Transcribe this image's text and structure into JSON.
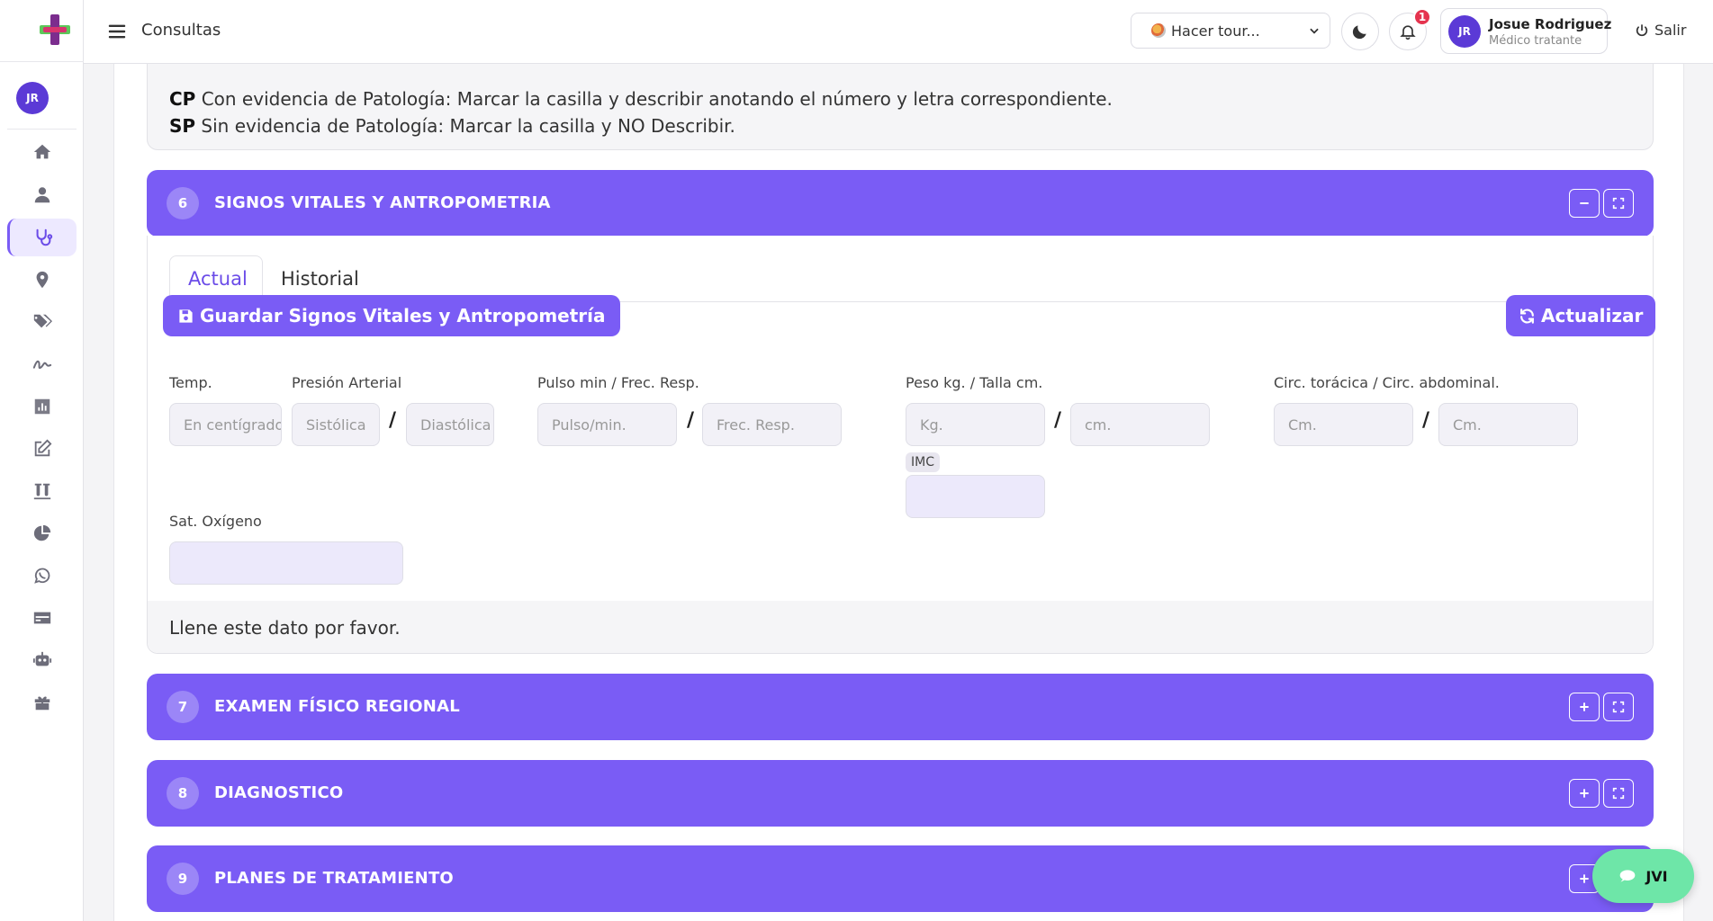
{
  "topbar": {
    "title": "Consultas",
    "tour_label": "Hacer tour...",
    "notification_count": "1",
    "user_initials": "JR",
    "user_name": "Josue Rodriguez",
    "user_role": "Médico tratante",
    "logout_label": "Salir"
  },
  "sidebar": {
    "avatar_initials": "JR",
    "items": [
      {
        "icon": "home-icon",
        "active": false
      },
      {
        "icon": "user-icon",
        "active": false
      },
      {
        "icon": "stethoscope-icon",
        "active": true
      },
      {
        "icon": "map-marker-icon",
        "active": false
      },
      {
        "icon": "tags-icon",
        "active": false
      },
      {
        "icon": "signature-icon",
        "active": false
      },
      {
        "icon": "chart-bar-icon",
        "active": false
      },
      {
        "icon": "edit-icon",
        "active": false
      },
      {
        "icon": "vials-icon",
        "active": false
      },
      {
        "icon": "pie-chart-icon",
        "active": false
      },
      {
        "icon": "whatsapp-icon",
        "active": false
      },
      {
        "icon": "credit-card-icon",
        "active": false
      },
      {
        "icon": "robot-icon",
        "active": false
      },
      {
        "icon": "gift-icon",
        "active": false
      }
    ]
  },
  "info": {
    "cp_code": "CP",
    "cp_text": " Con evidencia de Patología: Marcar la casilla y describir anotando el número y letra correspondiente.",
    "sp_code": "SP",
    "sp_text": " Sin evidencia de Patología: Marcar la casilla y NO Describir."
  },
  "sections": [
    {
      "number": "6",
      "title": "SIGNOS VITALES Y ANTROPOMETRIA",
      "expanded": true
    },
    {
      "number": "7",
      "title": "EXAMEN FÍSICO REGIONAL",
      "expanded": false
    },
    {
      "number": "8",
      "title": "DIAGNOSTICO",
      "expanded": false
    },
    {
      "number": "9",
      "title": "PLANES DE TRATAMIENTO",
      "expanded": false
    }
  ],
  "vitals": {
    "tabs": [
      "Actual",
      "Historial"
    ],
    "save_label": "Guardar Signos Vitales y Antropometría",
    "update_label": "Actualizar",
    "labels": {
      "temp": "Temp.",
      "pressure": "Presión Arterial",
      "pulse": "Pulso min / Frec. Resp.",
      "weight": "Peso kg. / Talla cm.",
      "circ": "Circ. torácica / Circ. abdominal.",
      "imc": "IMC",
      "sat": "Sat. Oxígeno"
    },
    "placeholders": {
      "temp": "En centígrados",
      "systolic": "Sistólica",
      "diastolic": "Diastólica",
      "pulse": "Pulso/min.",
      "resp": "Frec. Resp.",
      "weight": "Kg.",
      "height": "cm.",
      "thoracic": "Cm.",
      "abdominal": "Cm."
    },
    "separator": "/",
    "footer_note": "Llene este dato por favor."
  },
  "chat": {
    "label": "JVI"
  }
}
